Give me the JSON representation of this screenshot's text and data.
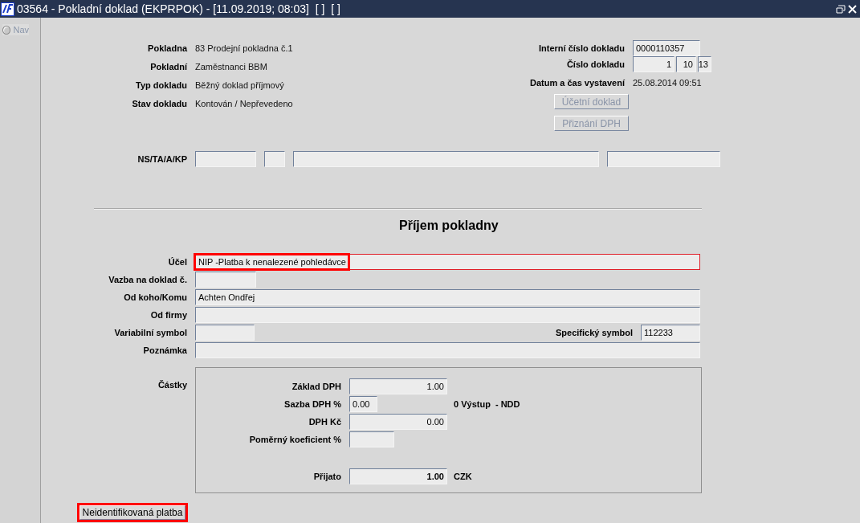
{
  "window": {
    "title": "03564 - Pokladní doklad (EKPRPOK) - [11.09.2019; 08:03]  [ ]  [ ]"
  },
  "nav": {
    "label": "Nav",
    "selected": false
  },
  "header_left": [
    {
      "label": "Pokladna",
      "value": "83 Prodejní pokladna č.1"
    },
    {
      "label": "Pokladní",
      "value": "Zaměstnanci BBM"
    },
    {
      "label": "Typ dokladu",
      "value": "Běžný doklad příjmový"
    },
    {
      "label": "Stav dokladu",
      "value": "Kontován / Nepřevedeno"
    }
  ],
  "header_right": {
    "internal_number": {
      "label": "Interní číslo dokladu",
      "value": "0000110357"
    },
    "document_number": {
      "label": "Číslo dokladu",
      "parts": [
        "1",
        "10",
        "13"
      ]
    },
    "issued": {
      "label": "Datum a čas vystavení",
      "value": "25.08.2014 09:51"
    }
  },
  "buttons": [
    {
      "label": "Účetní doklad",
      "disabled": true
    },
    {
      "label": "Přiznání DPH",
      "disabled": true
    }
  ],
  "ns_ta_a_kp": {
    "label": "NS/TA/A/KP"
  },
  "section_title": "Příjem pokladny",
  "form": [
    {
      "kind": "wide",
      "label": "Účel",
      "value": "NIP -Platba k nenalezené pohledávce",
      "highlighted": true
    },
    {
      "kind": "short",
      "label": "Vazba na doklad č."
    },
    {
      "kind": "wide",
      "label": "Od koho/Komu",
      "value": "Achten Ondřej",
      "highlighted": false
    },
    {
      "kind": "wide",
      "label": "Od firmy",
      "highlighted": false
    },
    {
      "kind": "pair",
      "label": "Variabilní symbol",
      "side_label": "Specifický symbol",
      "side_value": "112233"
    },
    {
      "kind": "wide",
      "label": "Poznámka",
      "highlighted": false
    }
  ],
  "amounts": {
    "label": "Částky",
    "rows": [
      {
        "kind": "wide",
        "label": "Základ DPH",
        "value": "1.00"
      },
      {
        "kind": "narrow",
        "label": "Sazba DPH %",
        "value": "0.00",
        "note": "0 Výstup  - NDD"
      },
      {
        "kind": "wide",
        "label": "DPH Kč",
        "value": "0.00"
      },
      {
        "kind": "narrow",
        "label": "Poměrný koeficient %"
      },
      {
        "kind": "total",
        "label": "Přijato",
        "value": "1.00",
        "note": "CZK"
      }
    ]
  },
  "footer_button": {
    "label": "Neidentifikovaná platba",
    "highlighted": true
  }
}
